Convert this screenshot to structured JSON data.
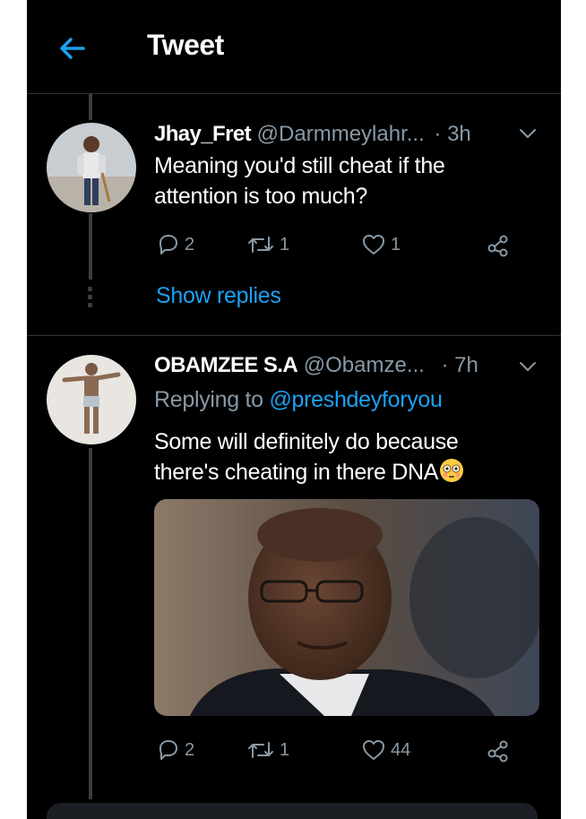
{
  "header": {
    "title": "Tweet"
  },
  "tweets": [
    {
      "display_name": "Jhay_Fret",
      "handle": "@Darmmeylahr...",
      "time": "· 3h",
      "text_line1": "Meaning you'd still cheat if the",
      "text_line2": "attention is too much?",
      "replies": "2",
      "retweets": "1",
      "likes": "1",
      "show_replies": "Show replies"
    },
    {
      "display_name": "OBAMZEE S.A",
      "handle": "@Obamze...",
      "time": "· 7h",
      "replying_prefix": "Replying to",
      "replying_handle": "@preshdeyforyou",
      "text_line1": "Some will definitely do because",
      "text_line2": "there's cheating in there DNA",
      "emoji": "flushed-face",
      "replies": "2",
      "retweets": "1",
      "likes": "44"
    }
  ],
  "colors": {
    "background": "#000000",
    "accent": "#1da1f2",
    "muted": "#8899a6",
    "divider": "#2f3336"
  }
}
